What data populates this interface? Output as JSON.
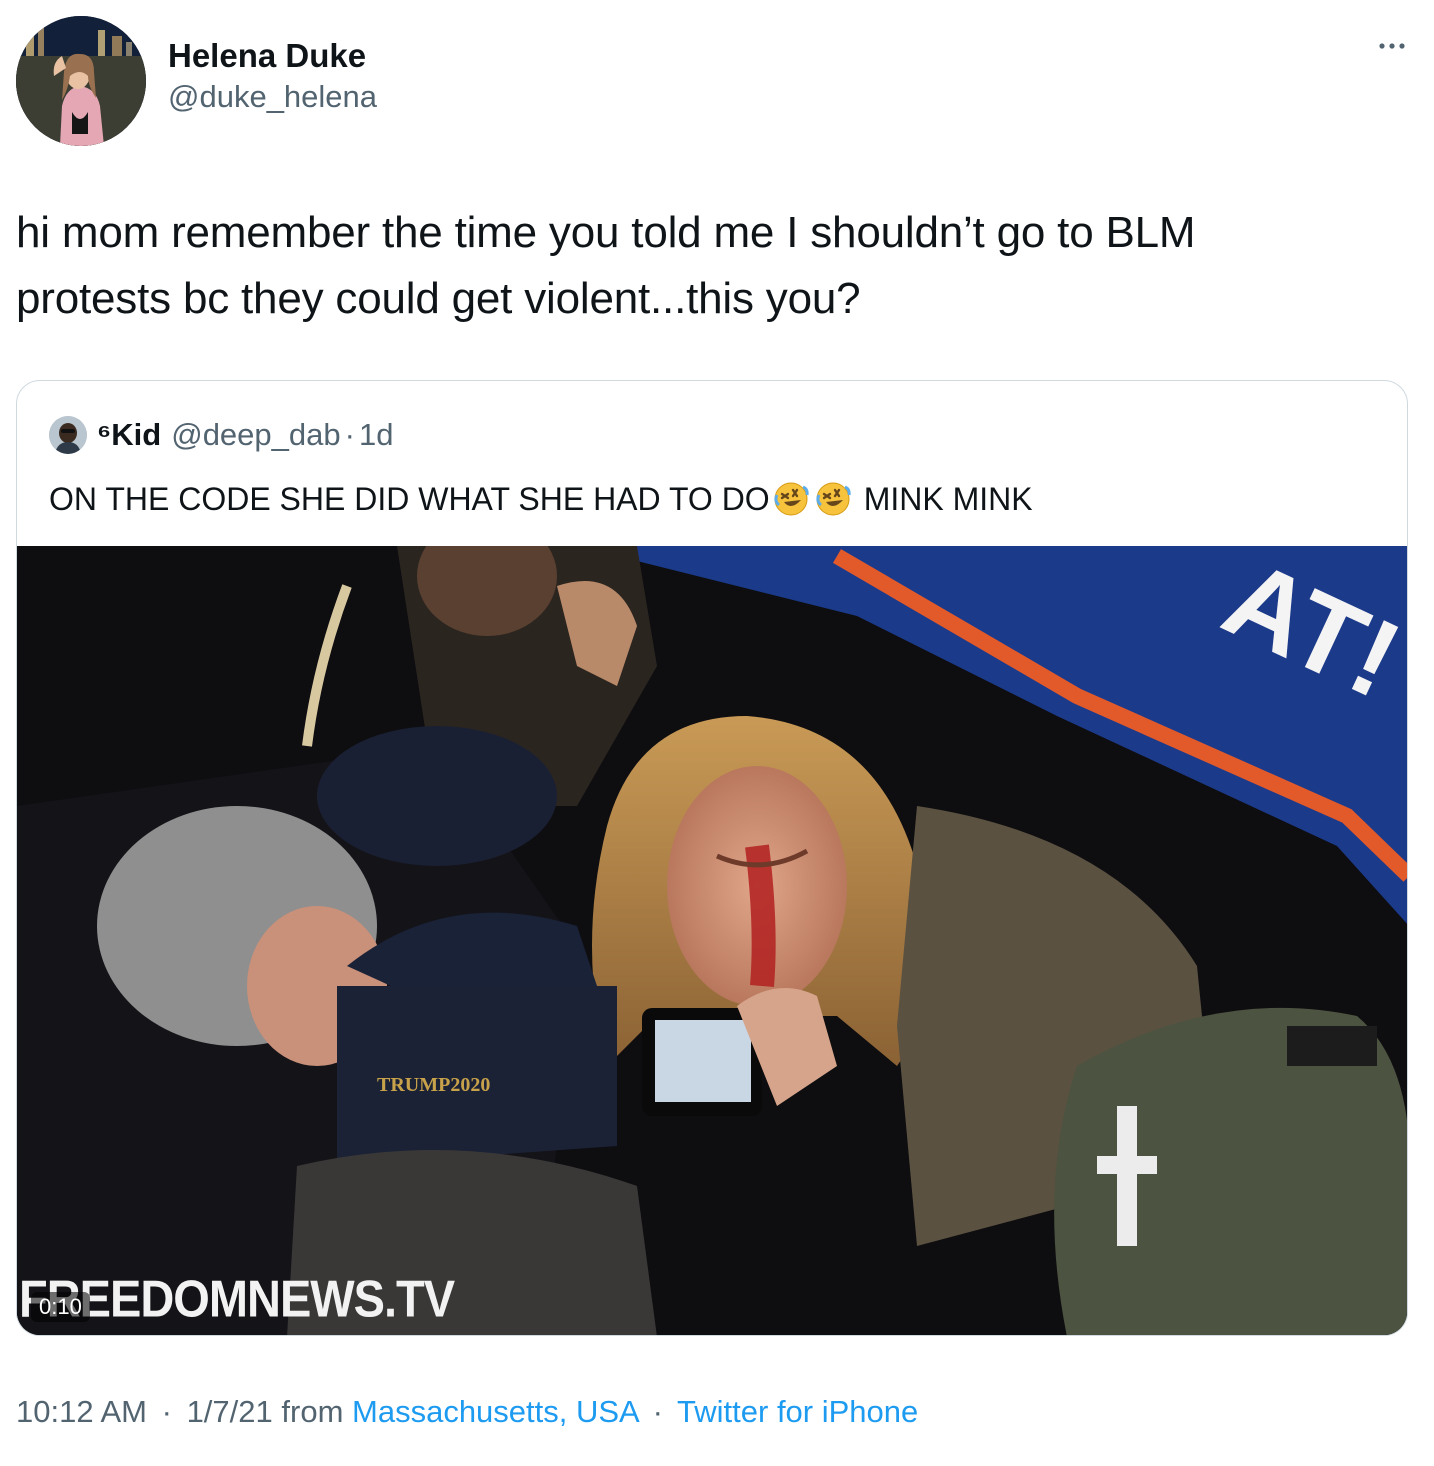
{
  "author": {
    "display_name": "Helena Duke",
    "handle": "@duke_helena",
    "avatar_icon": "profile-photo"
  },
  "more_icon": "more-horizontal-icon",
  "tweet": {
    "text_line1": "hi mom remember the time you told me I shouldn’t go to BLM",
    "text_line2": "protests bc they could get violent...this you?"
  },
  "quoted_tweet": {
    "display_name": "⁶Kid",
    "handle": "@deep_dab",
    "separator": "·",
    "time": "1d",
    "text_before": "ON THE CODE SHE DID WHAT SHE HAD TO DO",
    "emoji": "rolling-on-floor-laughing",
    "text_after": "MINK MINK",
    "video": {
      "duration": "0:10",
      "watermark": "FREEDOMNEWS.TV",
      "hat_text": "TRUMP2020"
    }
  },
  "meta": {
    "time": "10:12 AM",
    "separator": "·",
    "date": "1/7/21",
    "from_label": "from",
    "location": "Massachusetts, USA",
    "client": "Twitter for iPhone"
  },
  "colors": {
    "text": "#0f1419",
    "secondary": "#536471",
    "link": "#1d9bf0",
    "border": "#cfd9de"
  }
}
